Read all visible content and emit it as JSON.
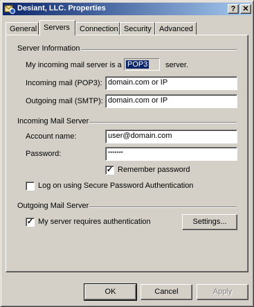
{
  "window": {
    "title": "Desiant, LLC. Properties",
    "help_label": "?",
    "close_label": "✕"
  },
  "tabs": [
    {
      "label": "General"
    },
    {
      "label": "Servers"
    },
    {
      "label": "Connection"
    },
    {
      "label": "Security"
    },
    {
      "label": "Advanced"
    }
  ],
  "active_tab": "Servers",
  "server_info": {
    "heading": "Server Information",
    "incoming_type_prefix": "My incoming mail server is a",
    "incoming_type_value": "POP3",
    "incoming_type_suffix": "server.",
    "incoming_label": "Incoming mail (POP3):",
    "incoming_value": "domain.com or IP",
    "outgoing_label": "Outgoing mail (SMTP):",
    "outgoing_value": "domain.com or IP"
  },
  "incoming_server": {
    "heading": "Incoming Mail Server",
    "account_label": "Account name:",
    "account_value": "user@domain.com",
    "password_label": "Password:",
    "password_value": "*******",
    "remember_label": "Remember password",
    "remember_checked": true,
    "spa_label": "Log on using Secure Password Authentication",
    "spa_checked": false
  },
  "outgoing_server": {
    "heading": "Outgoing Mail Server",
    "auth_label": "My server requires authentication",
    "auth_checked": true,
    "settings_label": "Settings..."
  },
  "footer": {
    "ok_label": "OK",
    "cancel_label": "Cancel",
    "apply_label": "Apply"
  },
  "colors": {
    "title_gradient_start": "#0a246a",
    "title_gradient_end": "#a6caf0",
    "face": "#d4d0c8"
  }
}
